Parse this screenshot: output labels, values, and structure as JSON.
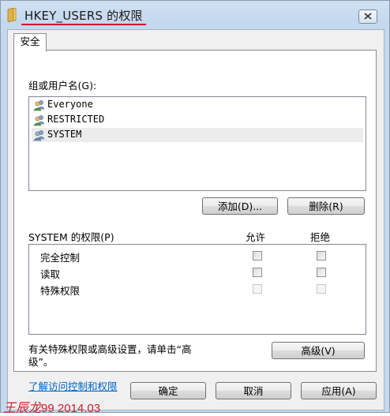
{
  "window": {
    "title": "HKEY_USERS 的权限",
    "accent_underline": "#d0182c"
  },
  "tabs": [
    {
      "label": "安全",
      "active": true
    }
  ],
  "groups": {
    "label": "组或用户名(G):",
    "items": [
      {
        "name": "Everyone",
        "icon": "users-icon",
        "selected": false
      },
      {
        "name": "RESTRICTED",
        "icon": "users-icon",
        "selected": false
      },
      {
        "name": "SYSTEM",
        "icon": "users-icon",
        "selected": true
      }
    ],
    "add_button": "添加(D)...",
    "remove_button": "删除(R)"
  },
  "permissions": {
    "title": "SYSTEM 的权限(P)",
    "allow_header": "允许",
    "deny_header": "拒绝",
    "rows": [
      {
        "label": "完全控制",
        "allow_enabled": true,
        "deny_enabled": true
      },
      {
        "label": "读取",
        "allow_enabled": true,
        "deny_enabled": true
      },
      {
        "label": "特殊权限",
        "allow_enabled": false,
        "deny_enabled": false
      }
    ]
  },
  "advanced": {
    "text_line1": "有关特殊权限或高级设置，请单击“高",
    "text_line2": "级”。",
    "button": "高级(V)"
  },
  "link": "了解访问控制和权限",
  "footer": {
    "ok": "确定",
    "cancel": "取消",
    "apply": "应用(A)"
  },
  "watermark": {
    "signature": "王辰龙",
    "date": "99 2014.03"
  }
}
